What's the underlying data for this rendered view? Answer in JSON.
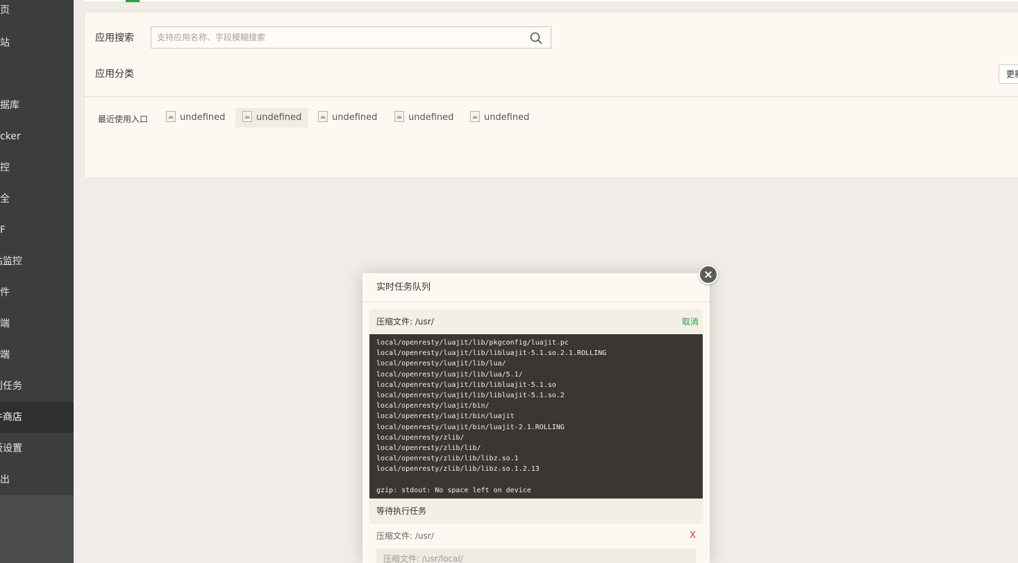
{
  "sidebar": {
    "items": [
      {
        "label": "页"
      },
      {
        "label": "站"
      },
      {
        "label": ""
      },
      {
        "label": "据库"
      },
      {
        "label": "cker"
      },
      {
        "label": "控"
      },
      {
        "label": "全"
      },
      {
        "label": "F"
      },
      {
        "label": "站监控"
      },
      {
        "label": "件"
      },
      {
        "label": "端"
      },
      {
        "label": "端"
      },
      {
        "label": "划任务"
      },
      {
        "label": "件商店"
      },
      {
        "label": "板设置"
      },
      {
        "label": "出"
      }
    ],
    "active_index": 13
  },
  "store": {
    "search_label": "应用搜索",
    "search_placeholder": "支持应用名称、字段模糊搜索",
    "category_label": "应用分类",
    "update_button": "更新",
    "recent_label": "最近使用入口",
    "recent_items": [
      "undefined",
      "undefined",
      "undefined",
      "undefined",
      "undefined"
    ]
  },
  "modal": {
    "title": "实时任务队列",
    "current_task": "压缩文件: /usr/",
    "cancel_label": "取消",
    "log_lines": [
      "local/openresty/luajit/lib/pkgconfig/luajit.pc",
      "local/openresty/luajit/lib/libluajit-5.1.so.2.1.ROLLING",
      "local/openresty/luajit/lib/lua/",
      "local/openresty/luajit/lib/lua/5.1/",
      "local/openresty/luajit/lib/libluajit-5.1.so",
      "local/openresty/luajit/lib/libluajit-5.1.so.2",
      "local/openresty/luajit/bin/",
      "local/openresty/luajit/bin/luajit",
      "local/openresty/luajit/bin/luajit-2.1.ROLLING",
      "local/openresty/zlib/",
      "local/openresty/zlib/lib/",
      "local/openresty/zlib/lib/libz.so.1",
      "local/openresty/zlib/lib/libz.so.1.2.13",
      "",
      "gzip: stdout: No space left on device"
    ],
    "waiting_label": "等待执行任务",
    "waiting_tasks": [
      {
        "label": "压缩文件: /usr/",
        "remove": "X"
      },
      {
        "label": "压缩文件: /usr/local/"
      }
    ]
  },
  "colors": {
    "sidebar_bg": "#3c3d3e",
    "accent_green": "#20a53a",
    "danger_red": "#e0342f",
    "log_bg": "#3a3631"
  }
}
